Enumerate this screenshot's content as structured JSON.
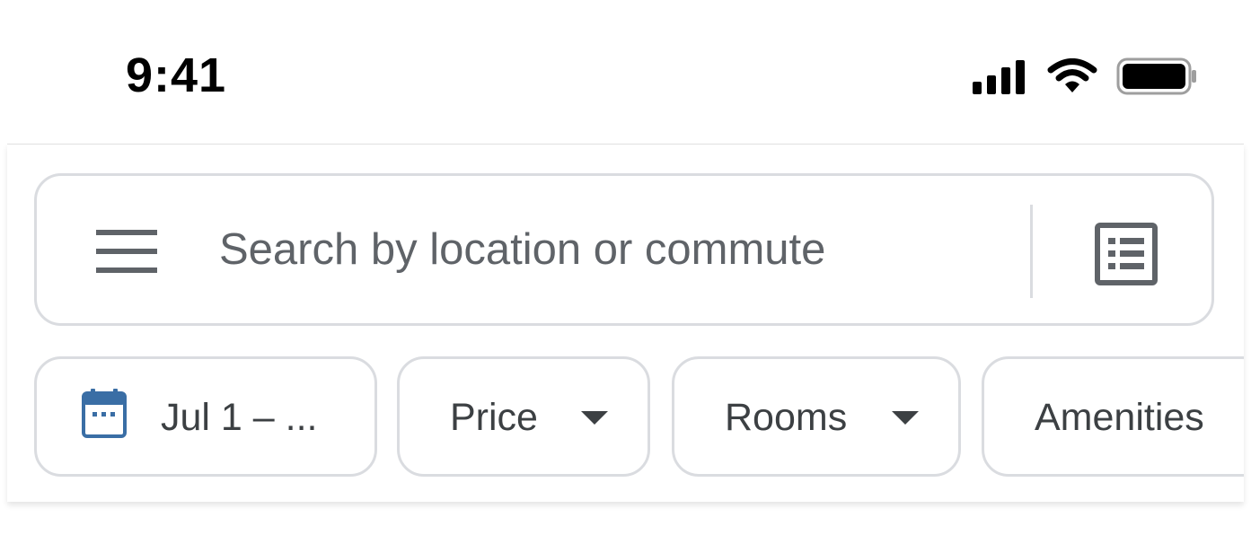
{
  "status_bar": {
    "time": "9:41",
    "icons": [
      "cellular-signal-icon",
      "wifi-icon",
      "battery-icon"
    ]
  },
  "search": {
    "placeholder": "Search by location or commute",
    "menu_icon": "hamburger-menu-icon",
    "list_view_icon": "list-view-icon"
  },
  "filters": {
    "dates_label": "Jul 1  – ...",
    "dates_icon": "calendar-icon",
    "price_label": "Price",
    "rooms_label": "Rooms",
    "amenities_label": "Amenities"
  },
  "colors": {
    "text_primary": "#3c4043",
    "text_secondary": "#5f6368",
    "border": "#dadce0",
    "calendar_blue": "#3a6ea5"
  }
}
